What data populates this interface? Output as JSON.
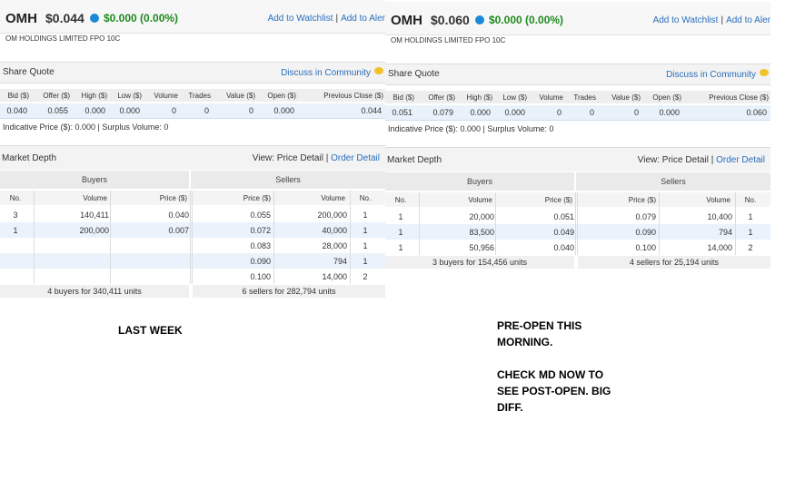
{
  "panels": [
    {
      "ticker": "OMH",
      "price": "$0.044",
      "change": "$0.000 (0.00%)",
      "watchlist_link": "Add to Watchlist",
      "alert_link": "Add to Aler",
      "company": "OM HOLDINGS LIMITED FPO 10C",
      "share_quote": {
        "title": "Share Quote",
        "community_link": "Discuss in Community",
        "headers": [
          "Bid ($)",
          "Offer ($)",
          "High ($)",
          "Low ($)",
          "Volume",
          "Trades",
          "Value ($)",
          "Open ($)",
          "Previous Close ($)"
        ],
        "values": [
          "0.040",
          "0.055",
          "0.000",
          "0.000",
          "0",
          "0",
          "0",
          "0.000",
          "0.044"
        ],
        "indicative": "Indicative Price ($): 0.000 | Surplus Volume: 0"
      },
      "market_depth": {
        "title": "Market Depth",
        "view_label": "View:",
        "price_detail": "Price Detail",
        "order_detail": "Order Detail",
        "buyers_label": "Buyers",
        "sellers_label": "Sellers",
        "buyer_headers": [
          "No.",
          "Volume",
          "Price ($)"
        ],
        "seller_headers": [
          "Price ($)",
          "Volume",
          "No."
        ],
        "buyers": [
          {
            "no": "3",
            "volume": "140,411",
            "price": "0.040"
          },
          {
            "no": "1",
            "volume": "200,000",
            "price": "0.007"
          }
        ],
        "sellers": [
          {
            "price": "0.055",
            "volume": "200,000",
            "no": "1"
          },
          {
            "price": "0.072",
            "volume": "40,000",
            "no": "1"
          },
          {
            "price": "0.083",
            "volume": "28,000",
            "no": "1"
          },
          {
            "price": "0.090",
            "volume": "794",
            "no": "1"
          },
          {
            "price": "0.100",
            "volume": "14,000",
            "no": "2"
          }
        ],
        "buyers_summary": "4 buyers for 340,411 units",
        "sellers_summary": "6 sellers for 282,794 units"
      }
    },
    {
      "ticker": "OMH",
      "price": "$0.060",
      "change": "$0.000 (0.00%)",
      "watchlist_link": "Add to Watchlist",
      "alert_link": "Add to Aler",
      "company": "OM HOLDINGS LIMITED FPO 10C",
      "share_quote": {
        "title": "Share Quote",
        "community_link": "Discuss in Community",
        "headers": [
          "Bid ($)",
          "Offer ($)",
          "High ($)",
          "Low ($)",
          "Volume",
          "Trades",
          "Value ($)",
          "Open ($)",
          "Previous Close ($)"
        ],
        "values": [
          "0.051",
          "0.079",
          "0.000",
          "0.000",
          "0",
          "0",
          "0",
          "0.000",
          "0.060"
        ],
        "indicative": "Indicative Price ($): 0.000 | Surplus Volume: 0"
      },
      "market_depth": {
        "title": "Market Depth",
        "view_label": "View:",
        "price_detail": "Price Detail",
        "order_detail": "Order Detail",
        "buyers_label": "Buyers",
        "sellers_label": "Sellers",
        "buyer_headers": [
          "No.",
          "Volume",
          "Price ($)"
        ],
        "seller_headers": [
          "Price ($)",
          "Volume",
          "No."
        ],
        "buyers": [
          {
            "no": "1",
            "volume": "20,000",
            "price": "0.051"
          },
          {
            "no": "1",
            "volume": "83,500",
            "price": "0.049"
          },
          {
            "no": "1",
            "volume": "50,956",
            "price": "0.040"
          }
        ],
        "sellers": [
          {
            "price": "0.079",
            "volume": "10,400",
            "no": "1"
          },
          {
            "price": "0.090",
            "volume": "794",
            "no": "1"
          },
          {
            "price": "0.100",
            "volume": "14,000",
            "no": "2"
          }
        ],
        "buyers_summary": "3 buyers for 154,456 units",
        "sellers_summary": "4 sellers for 25,194 units"
      }
    }
  ],
  "notes": {
    "last_week": "LAST WEEK",
    "preopen_lines": [
      "PRE-OPEN THIS",
      "MORNING."
    ],
    "check_lines": [
      "CHECK MD NOW TO",
      "SEE POST-OPEN. BIG",
      "DIFF."
    ]
  },
  "colors": {
    "link": "#2a6ebb",
    "positive": "#1e8a1e",
    "dot": "#1b8ad6",
    "quote_row_bg": "#e9f2fb"
  }
}
